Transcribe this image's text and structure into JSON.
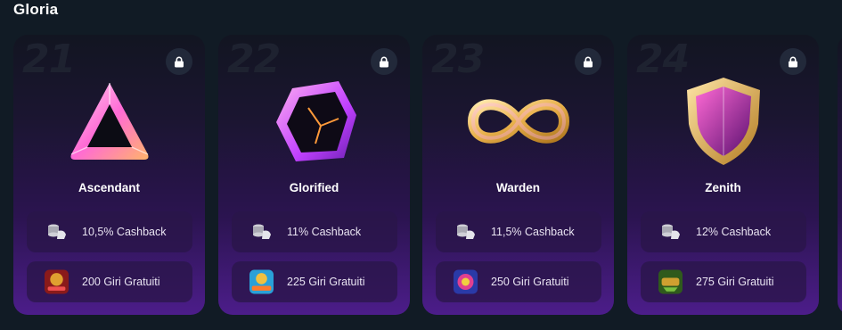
{
  "section": {
    "title": "Gloria"
  },
  "cards": [
    {
      "level": "21",
      "name": "Ascendant",
      "cashback": "10,5% Cashback",
      "spins": "200 Giri Gratuiti",
      "emblem_icon": "triangle-gem-icon",
      "game_icon": "game-thumbnail-icon",
      "thumb_colors": [
        "#8a1a1a",
        "#e0a030"
      ]
    },
    {
      "level": "22",
      "name": "Glorified",
      "cashback": "11% Cashback",
      "spins": "225 Giri Gratuiti",
      "emblem_icon": "crystal-rock-icon",
      "game_icon": "game-thumbnail-icon",
      "thumb_colors": [
        "#2aa0d8",
        "#f0c040"
      ]
    },
    {
      "level": "23",
      "name": "Warden",
      "cashback": "11,5% Cashback",
      "spins": "250 Giri Gratuiti",
      "emblem_icon": "infinity-icon",
      "game_icon": "game-thumbnail-icon",
      "thumb_colors": [
        "#2a3aa8",
        "#e04090"
      ]
    },
    {
      "level": "24",
      "name": "Zenith",
      "cashback": "12% Cashback",
      "spins": "275 Giri Gratuiti",
      "emblem_icon": "shield-icon",
      "game_icon": "game-thumbnail-icon",
      "thumb_colors": [
        "#2f5a1c",
        "#d0a030"
      ]
    }
  ],
  "icons": {
    "lock": "lock-icon",
    "cashback": "cashback-icon"
  },
  "colors": {
    "background": "#111b25",
    "card_bottom": "#4c1d8a",
    "gem_pink": "#ff6ad5",
    "gold": "#e8b04a"
  }
}
